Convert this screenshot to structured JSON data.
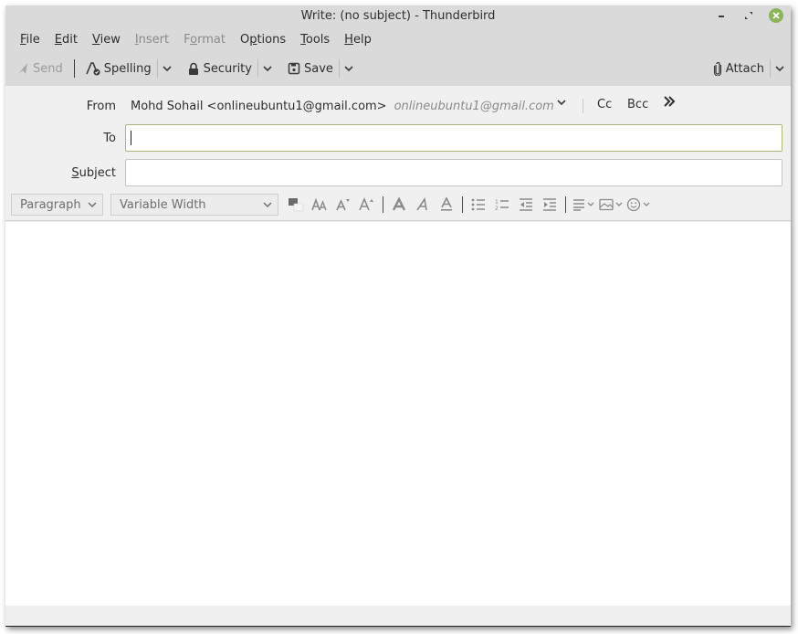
{
  "window": {
    "title": "Write: (no subject) - Thunderbird",
    "controls": {
      "minimize_icon": "minimize-icon",
      "maximize_icon": "maximize-icon",
      "close_icon": "close-icon",
      "close_color": "#8cb45a"
    }
  },
  "menubar": {
    "items": [
      {
        "label": "File",
        "mnemonic": "F",
        "rest": "ile",
        "disabled": false
      },
      {
        "label": "Edit",
        "mnemonic": "E",
        "rest": "dit",
        "disabled": false
      },
      {
        "label": "View",
        "mnemonic": "V",
        "rest": "iew",
        "disabled": false
      },
      {
        "label": "Insert",
        "mnemonic": "I",
        "rest": "nsert",
        "disabled": true
      },
      {
        "label": "Format",
        "pre": "F",
        "mnemonic": "o",
        "rest": "rmat",
        "disabled": true
      },
      {
        "label": "Options",
        "pre": "O",
        "mnemonic": "p",
        "rest": "tions",
        "disabled": false
      },
      {
        "label": "Tools",
        "mnemonic": "T",
        "rest": "ools",
        "disabled": false
      },
      {
        "label": "Help",
        "mnemonic": "H",
        "rest": "elp",
        "disabled": false
      }
    ]
  },
  "toolbar": {
    "send_label": "Send",
    "spelling_label": "Spelling",
    "security_label": "Security",
    "save_label": "Save",
    "attach_label": "Attach"
  },
  "compose": {
    "from_label": "From",
    "from_value": "Mohd Sohail <onlineubuntu1@gmail.com>",
    "from_alias": "onlineubuntu1@gmail.com",
    "cc_label": "Cc",
    "bcc_label": "Bcc",
    "to_label": "To",
    "to_value": "",
    "subject_label": "Subject",
    "subject_value": ""
  },
  "format_bar": {
    "paragraph_format": "Paragraph",
    "font": "Variable Width"
  },
  "colors": {
    "header_bg": "#dadada",
    "panel_bg": "#f0f0f0",
    "focus_border": "#a8b87a",
    "accent_green": "#8cb45a"
  }
}
